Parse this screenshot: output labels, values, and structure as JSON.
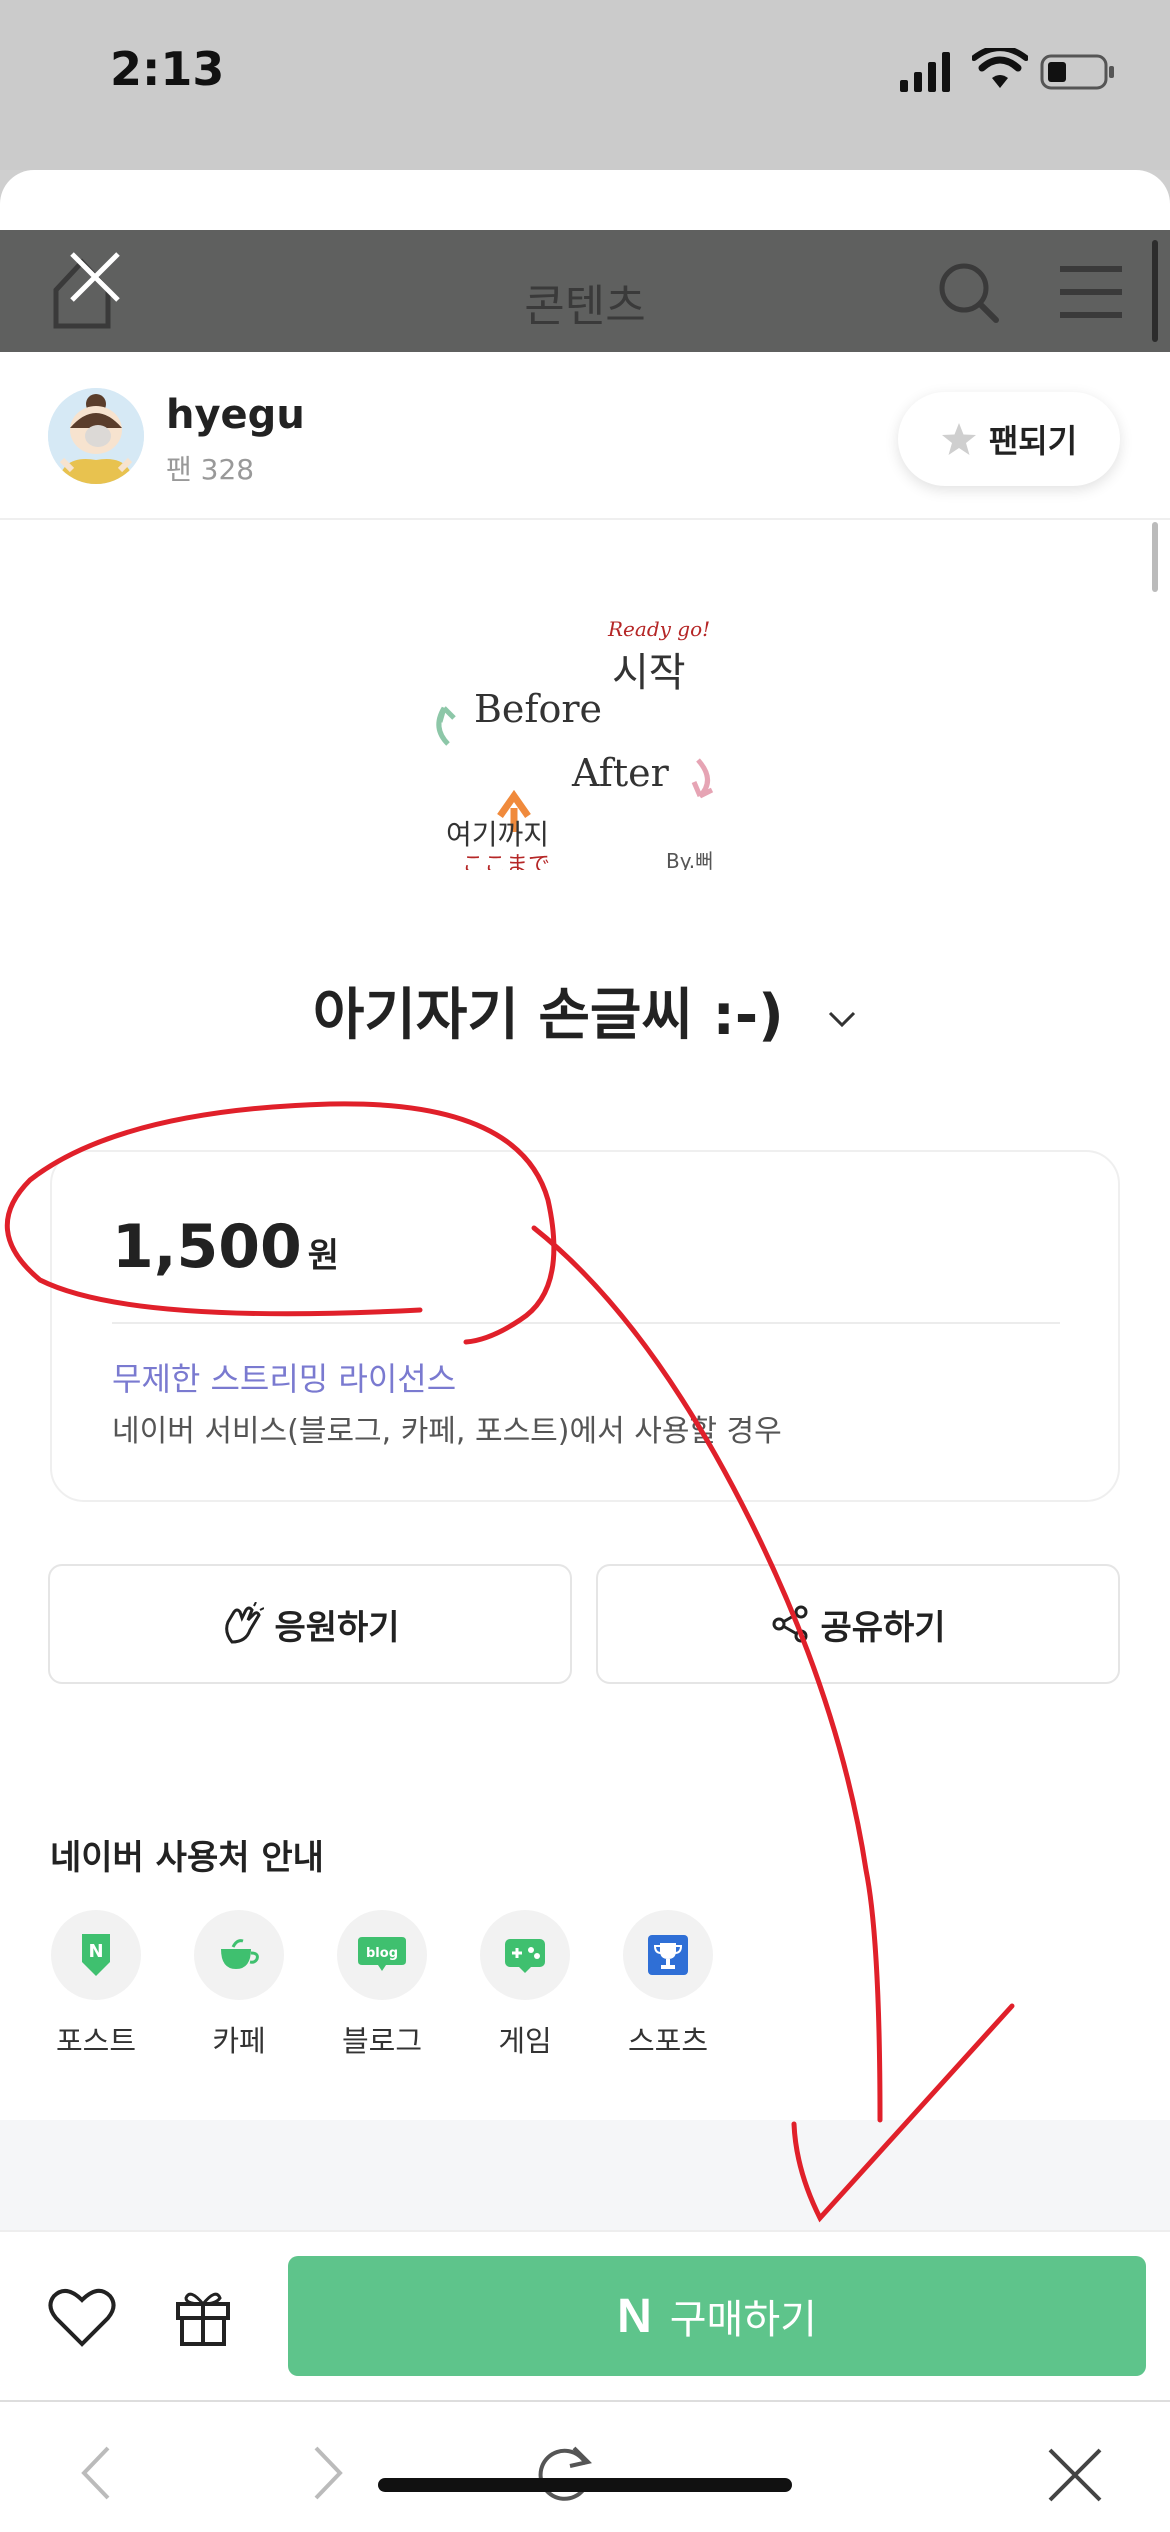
{
  "status_bar": {
    "time": "2:13"
  },
  "nav": {
    "title": "콘텐츠"
  },
  "profile": {
    "username": "hyegu",
    "fans": "팬 328",
    "fan_button": "팬되기"
  },
  "product": {
    "thumbnail_text": {
      "ready": "Ready go!",
      "start": "시작",
      "before": "Before",
      "after": "After",
      "here": "여기까지",
      "jp": "ここまで",
      "by": "By.뻐"
    },
    "title": "아기자기 손글씨 :-)",
    "price_value": "1,500",
    "price_unit": "원",
    "license": "무제한 스트리밍 라이선스",
    "license_desc": "네이버 서비스(블로그, 카페, 포스트)에서 사용할 경우"
  },
  "actions": {
    "cheer": "응원하기",
    "share": "공유하기"
  },
  "usage": {
    "title": "네이버 사용처 안내",
    "items": [
      {
        "label": "포스트",
        "icon": "post-icon"
      },
      {
        "label": "카페",
        "icon": "cafe-icon"
      },
      {
        "label": "블로그",
        "icon": "blog-icon",
        "badge": "blog"
      },
      {
        "label": "게임",
        "icon": "game-icon"
      },
      {
        "label": "스포츠",
        "icon": "sports-icon"
      }
    ]
  },
  "purchase": {
    "button": "구매하기",
    "n_mark": "N"
  },
  "colors": {
    "accent": "#5ec48b",
    "license": "#7a7ad0",
    "annotation": "#e0202a"
  }
}
